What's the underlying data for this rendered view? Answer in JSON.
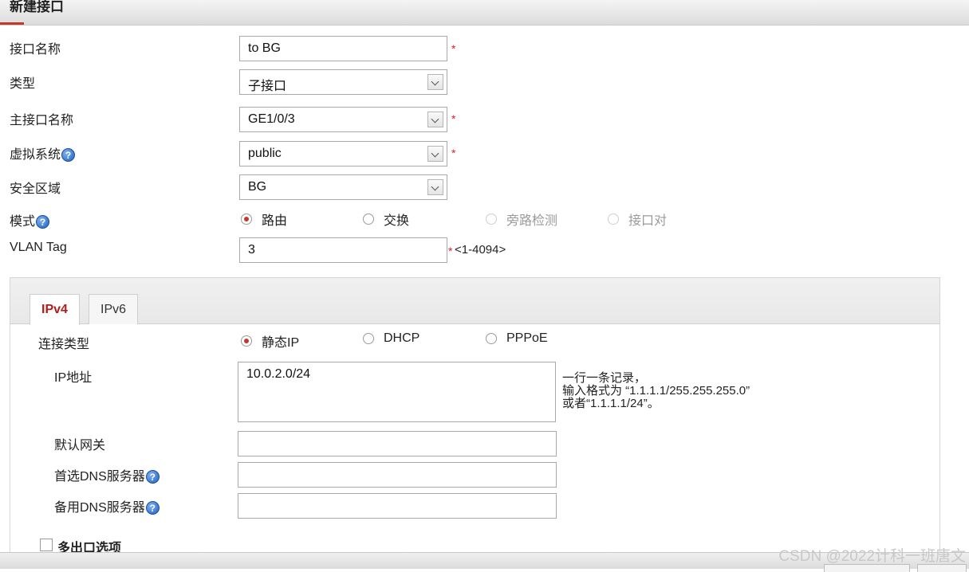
{
  "window": {
    "title": "新建接口"
  },
  "form": {
    "name": {
      "label": "接口名称",
      "value": "to BG",
      "required": "*"
    },
    "type": {
      "label": "类型",
      "value": "子接口"
    },
    "parent": {
      "label": "主接口名称",
      "value": "GE1/0/3",
      "required": "*"
    },
    "vsys": {
      "label": "虚拟系统",
      "value": "public",
      "required": "*"
    },
    "zone": {
      "label": "安全区域",
      "value": "BG"
    },
    "mode": {
      "label": "模式",
      "options": [
        "路由",
        "交换",
        "旁路检测",
        "接口对"
      ],
      "selected": "路由"
    },
    "vlan": {
      "label": "VLAN Tag",
      "value": "3",
      "required": "*",
      "range": "<1-4094>"
    }
  },
  "tabs": [
    {
      "label": "IPv4",
      "active": true
    },
    {
      "label": "IPv6",
      "active": false
    }
  ],
  "ipv4": {
    "conn_type": {
      "label": "连接类型",
      "options": [
        "静态IP",
        "DHCP",
        "PPPoE"
      ],
      "selected": "静态IP"
    },
    "ip": {
      "label": "IP地址",
      "value": "10.0.2.0/24",
      "hint": [
        "一行一条记录，",
        "输入格式为 “1.1.1.1/255.255.255.0”",
        "或者“1.1.1.1/24”。"
      ]
    },
    "gateway": {
      "label": "默认网关",
      "value": ""
    },
    "dns1": {
      "label": "首选DNS服务器",
      "value": ""
    },
    "dns2": {
      "label": "备用DNS服务器",
      "value": ""
    },
    "multi_exit": {
      "label": "多出口选项"
    }
  },
  "help_glyph": "?",
  "watermark": "CSDN @2022计科一班唐文",
  "colors": {
    "accent": "#b01c1c",
    "required": "#e02020",
    "help": "#1f5fbf"
  }
}
